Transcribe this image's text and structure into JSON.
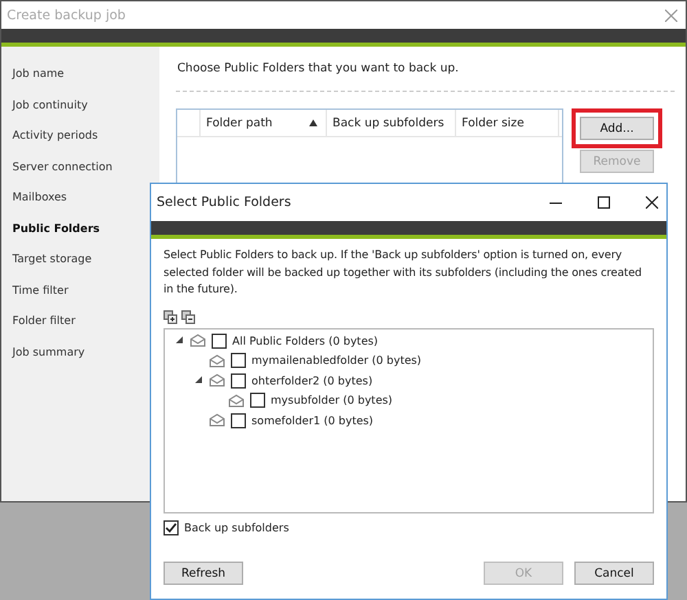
{
  "window": {
    "title": "Create backup job"
  },
  "sidebar": {
    "items": [
      {
        "label": "Job name",
        "selected": false
      },
      {
        "label": "Job continuity",
        "selected": false
      },
      {
        "label": "Activity periods",
        "selected": false
      },
      {
        "label": "Server connection",
        "selected": false
      },
      {
        "label": "Mailboxes",
        "selected": false
      },
      {
        "label": "Public Folders",
        "selected": true
      },
      {
        "label": "Target storage",
        "selected": false
      },
      {
        "label": "Time filter",
        "selected": false
      },
      {
        "label": "Folder filter",
        "selected": false
      },
      {
        "label": "Job summary",
        "selected": false
      }
    ]
  },
  "main": {
    "prompt": "Choose Public Folders that you want to back up.",
    "table": {
      "columns": [
        {
          "label": "Folder path",
          "sorted": true
        },
        {
          "label": "Back up subfolders",
          "sorted": false
        },
        {
          "label": "Folder size",
          "sorted": false
        }
      ]
    },
    "buttons": [
      {
        "label": "Add...",
        "disabled": false,
        "highlighted": true
      },
      {
        "label": "Remove",
        "disabled": true,
        "highlighted": false
      }
    ]
  },
  "dialog": {
    "title": "Select Public Folders",
    "description": "Select Public Folders to back up. If the 'Back up subfolders' option is turned on, every selected folder will be backed up together with its subfolders (including the ones created in the future).",
    "tree": [
      {
        "label": "All Public Folders (0 bytes)",
        "checked": false,
        "expanded": true,
        "children": [
          {
            "label": "mymailenabledfolder (0 bytes)",
            "checked": false
          },
          {
            "label": "ohterfolder2 (0 bytes)",
            "checked": false,
            "expanded": true,
            "children": [
              {
                "label": "mysubfolder (0 bytes)",
                "checked": false
              }
            ]
          },
          {
            "label": "somefolder1 (0 bytes)",
            "checked": false
          }
        ]
      }
    ],
    "option": {
      "label": "Back up subfolders",
      "checked": true
    },
    "buttons": [
      {
        "label": "Refresh",
        "disabled": false
      },
      {
        "label": "OK",
        "disabled": true
      },
      {
        "label": "Cancel",
        "disabled": false
      }
    ]
  }
}
